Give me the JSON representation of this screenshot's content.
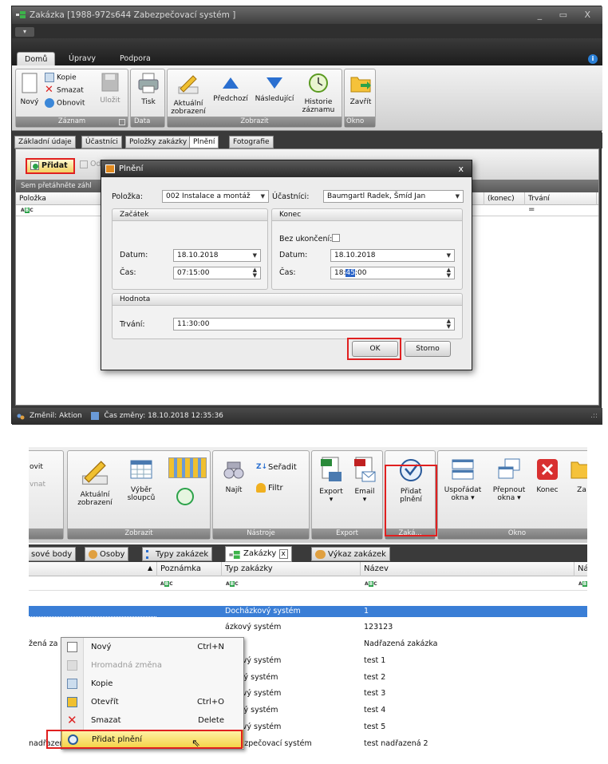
{
  "top": {
    "title": "Zakázka [1988-972s644 Zabezpečovací systém ]",
    "ribbon_tabs": [
      "Domů",
      "Úpravy",
      "Podpora"
    ],
    "groups": {
      "zaznam": {
        "label": "Záznam",
        "novy": "Nový",
        "kopie": "Kopie",
        "smazat": "Smazat",
        "obnovit": "Obnovit",
        "ulozit": "Uložit"
      },
      "data": {
        "label": "Data",
        "tisk": "Tisk"
      },
      "zobrazit": {
        "label": "Zobrazit",
        "aktualni_1": "Aktuální",
        "aktualni_2": "zobrazení",
        "predchozi": "Předchozí",
        "nasledujici": "Následující",
        "historie_1": "Historie",
        "historie_2": "záznamu"
      },
      "okno": {
        "label": "Okno",
        "zavrit": "Zavřít"
      }
    },
    "doc_tabs": [
      "Základní údaje",
      "Účastníci",
      "Položky zakázky",
      "Plnění",
      "Fotografie"
    ],
    "toolbar": {
      "pridat": "Přidat",
      "odebrat": "Od"
    },
    "groupbar": "Sem přetáhněte záhl",
    "grid_cols": {
      "polozka": "Položka",
      "konec": "(konec)",
      "trvani": "Trvání"
    },
    "filter_abc": "ABC",
    "filter_eq": "=",
    "status": {
      "zmenil": "Změnil: Aktion",
      "cas_zmeny": "Čas změny: 18.10.2018 12:35:36"
    }
  },
  "dialog": {
    "title": "Plnění",
    "close": "x",
    "polozka_label": "Položka:",
    "polozka_value": "002 Instalace a montáž",
    "ucastnici_label": "Účastníci:",
    "ucastnici_value": "Baumgartl Radek, Šmíd Jan",
    "zacatek": {
      "header": "Začátek",
      "datum_label": "Datum:",
      "datum": "18.10.2018",
      "cas_label": "Čas:",
      "cas": "07:15:00"
    },
    "konec": {
      "header": "Konec",
      "bez_label": "Bez ukončení:",
      "datum_label": "Datum:",
      "datum": "18.10.2018",
      "cas_label": "Čas:",
      "cas_h": "18:",
      "cas_m": "45",
      "cas_s": ":00"
    },
    "hodnota": {
      "header": "Hodnota",
      "trvani_label": "Trvání:",
      "trvani": "11:30:00"
    },
    "ok": "OK",
    "storno": "Storno"
  },
  "bottom": {
    "ribbon": {
      "ovit": "ovit",
      "vnat": "vnat",
      "aktualni_1": "Aktuální",
      "aktualni_2": "zobrazení",
      "vyber_1": "Výběr",
      "vyber_2": "sloupců",
      "najit": "Najít",
      "seradit": "Seřadit",
      "filtr": "Filtr",
      "export": "Export",
      "email": "Email",
      "pridat_1": "Přidat",
      "pridat_2": "plnění",
      "usporadat_1": "Uspořádat",
      "usporadat_2": "okna",
      "prepnout_1": "Přepnout",
      "prepnout_2": "okna",
      "konec": "Konec",
      "za": "Za",
      "group_zobrazit": "Zobrazit",
      "group_nastroje": "Nástroje",
      "group_export": "Export",
      "group_zaka": "Zaká...",
      "group_okno": "Okno"
    },
    "doc_tabs": [
      "sové body",
      "Osoby",
      "Typy zakázek",
      "Zakázky",
      "Výkaz zakázek"
    ],
    "tab_close": "x",
    "grid_cols": [
      "Poznámka",
      "Typ zakázky",
      "Název",
      "Ná"
    ],
    "rows": [
      {
        "left": "",
        "typ": "Docházkový systém",
        "nazev": "1"
      },
      {
        "left": "",
        "typ": "ázkový systém",
        "nazev": "123123"
      },
      {
        "left": "žená za",
        "typ": "",
        "nazev": "Nadřazená zakázka"
      },
      {
        "left": "",
        "typ": "ázkový systém",
        "nazev": "test 1"
      },
      {
        "left": "",
        "typ": "upový systém",
        "nazev": "test 2"
      },
      {
        "left": "",
        "typ": "ázkový systém",
        "nazev": "test 3"
      },
      {
        "left": "",
        "typ": "upový systém",
        "nazev": "test 4"
      },
      {
        "left": "",
        "typ": "ázkový systém",
        "nazev": "test 5"
      },
      {
        "left": "nadřazená 2",
        "typ": "Zabezpečovací systém",
        "nazev": "test nadřazená 2"
      }
    ],
    "menu": [
      {
        "label": "Nový",
        "key": "Ctrl+N"
      },
      {
        "label": "Hromadná změna",
        "key": ""
      },
      {
        "label": "Kopie",
        "key": ""
      },
      {
        "label": "Otevřít",
        "key": "Ctrl+O"
      },
      {
        "label": "Smazat",
        "key": "Delete"
      },
      {
        "label": "Přidat plnění",
        "key": ""
      }
    ]
  }
}
